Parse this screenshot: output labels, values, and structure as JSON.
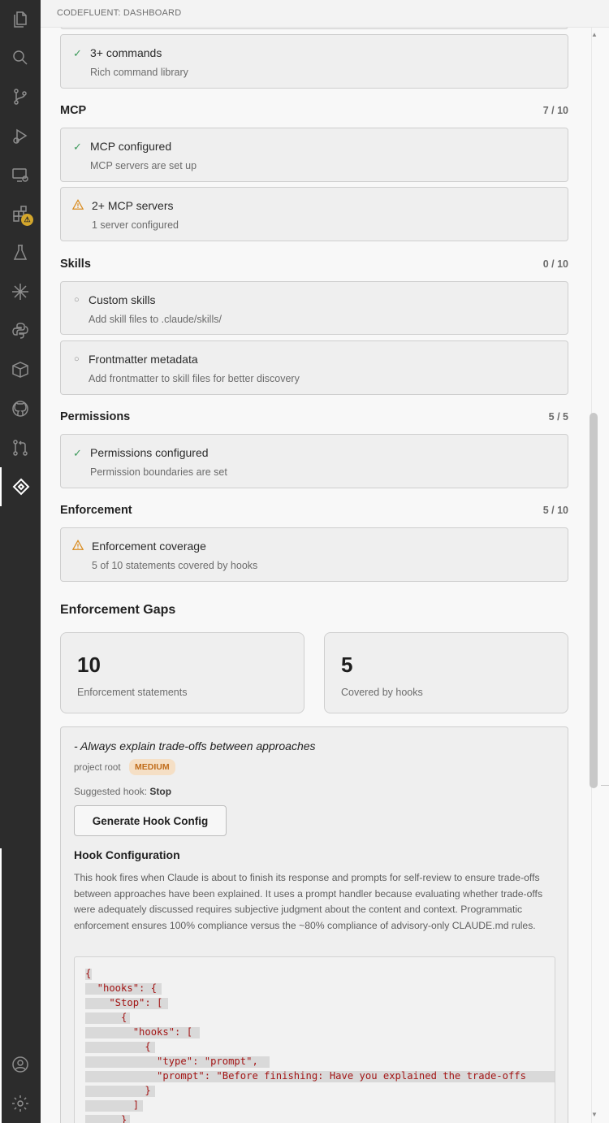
{
  "tab": {
    "title": "CODEFLUENT: DASHBOARD"
  },
  "activity_bar": {
    "icons": [
      "files-icon",
      "search-icon",
      "source-control-icon",
      "run-debug-icon",
      "remote-explorer-icon",
      "extensions-icon",
      "testing-icon",
      "sparkle-icon",
      "python-icon",
      "packages-icon",
      "github-icon",
      "pull-requests-icon",
      "codefluent-icon",
      "account-icon",
      "settings-gear-icon"
    ],
    "extensions_badge": "⚠"
  },
  "sections": {
    "commands": {
      "items": [
        {
          "status": "pass",
          "title": "3+ commands",
          "desc": "Rich command library"
        }
      ]
    },
    "mcp": {
      "name": "MCP",
      "score": "7 / 10",
      "items": [
        {
          "status": "pass",
          "title": "MCP configured",
          "desc": "MCP servers are set up"
        },
        {
          "status": "warn",
          "title": "2+ MCP servers",
          "desc": "1 server configured"
        }
      ]
    },
    "skills": {
      "name": "Skills",
      "score": "0 / 10",
      "items": [
        {
          "status": "todo",
          "title": "Custom skills",
          "desc": "Add skill files to .claude/skills/"
        },
        {
          "status": "todo",
          "title": "Frontmatter metadata",
          "desc": "Add frontmatter to skill files for better discovery"
        }
      ]
    },
    "permissions": {
      "name": "Permissions",
      "score": "5 / 5",
      "items": [
        {
          "status": "pass",
          "title": "Permissions configured",
          "desc": "Permission boundaries are set"
        }
      ]
    },
    "enforcement": {
      "name": "Enforcement",
      "score": "5 / 10",
      "items": [
        {
          "status": "warn",
          "title": "Enforcement coverage",
          "desc": "5 of 10 statements covered by hooks"
        }
      ]
    }
  },
  "gaps": {
    "title": "Enforcement Gaps",
    "stats": [
      {
        "value": "10",
        "label": "Enforcement statements"
      },
      {
        "value": "5",
        "label": "Covered by hooks"
      }
    ],
    "gap": {
      "statement": "- Always explain trade-offs between approaches",
      "scope": "project root",
      "severity": "MEDIUM",
      "suggested_prefix": "Suggested hook: ",
      "suggested_hook": "Stop",
      "generate_label": "Generate Hook Config",
      "hook_title": "Hook Configuration",
      "hook_desc": "This hook fires when Claude is about to finish its response and prompts for self-review to ensure trade-offs between approaches have been explained. It uses a prompt handler because evaluating whether trade-offs were adequately discussed requires subjective judgment about the content and context. Programmatic enforcement ensures 100% compliance versus the ~80% compliance of advisory-only CLAUDE.md rules.",
      "code_lines": [
        "{",
        "  \"hooks\": {",
        "    \"Stop\": [",
        "      {",
        "        \"hooks\": [",
        "          {",
        "            \"type\": \"prompt\",",
        "            \"prompt\": \"Before finishing: Have you explained the trade-offs",
        "          }",
        "        ]",
        "      }"
      ]
    }
  }
}
